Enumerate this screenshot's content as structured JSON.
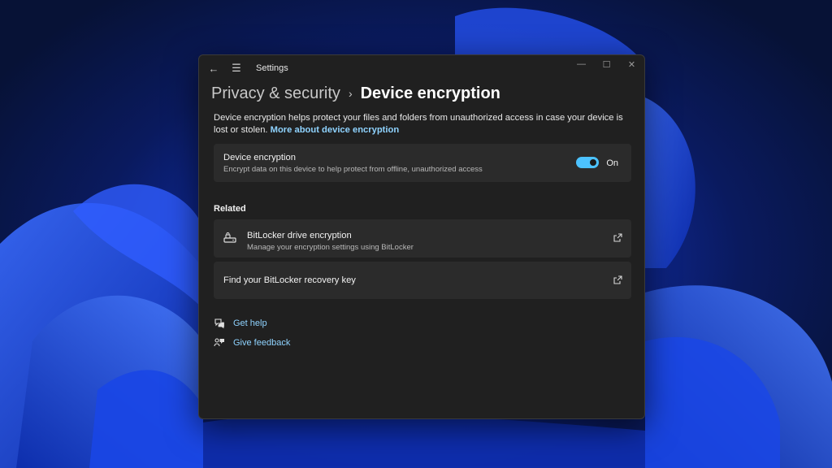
{
  "window": {
    "app_title": "Settings",
    "controls": {
      "minimize": "—",
      "maximize": "☐",
      "close": "✕"
    }
  },
  "breadcrumb": {
    "parent": "Privacy & security",
    "separator": "›",
    "current": "Device encryption"
  },
  "description": {
    "text": "Device encryption helps protect your files and folders from unauthorized access in case your device is lost or stolen.",
    "link": "More about device encryption"
  },
  "device_encryption": {
    "title": "Device encryption",
    "subtitle": "Encrypt data on this device to help protect from offline, unauthorized access",
    "toggle_on": true,
    "toggle_label": "On"
  },
  "related": {
    "heading": "Related",
    "items": [
      {
        "title": "BitLocker drive encryption",
        "subtitle": "Manage your encryption settings using BitLocker",
        "icon": "drive-lock-icon"
      },
      {
        "title": "Find your BitLocker recovery key",
        "subtitle": ""
      }
    ]
  },
  "help": {
    "get_help": "Get help",
    "give_feedback": "Give feedback"
  },
  "colors": {
    "accent": "#4cc2ff",
    "link": "#8fd3ff",
    "window_bg": "#202020",
    "card_bg": "#2b2b2b"
  }
}
